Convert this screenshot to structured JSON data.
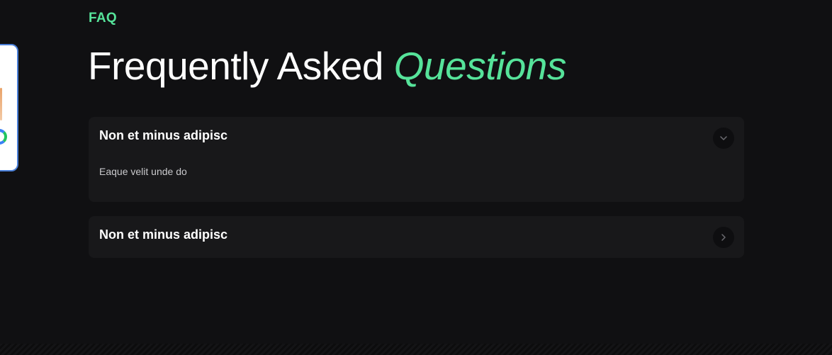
{
  "section": {
    "eyebrow": "FAQ",
    "title_main": "Frequently Asked ",
    "title_accent": "Questions"
  },
  "faq": {
    "items": [
      {
        "question": "Non et minus adipisc",
        "answer": "Eaque velit unde do",
        "expanded": true,
        "toggle_icon": "chevron-down-icon"
      },
      {
        "question": "Non et minus adipisc",
        "expanded": false,
        "toggle_icon": "chevron-right-icon"
      }
    ]
  },
  "colors": {
    "background": "#101012",
    "card": "#18181a",
    "accent": "#56e39a",
    "text": "#ffffff",
    "muted_text": "#c9c9cc"
  }
}
